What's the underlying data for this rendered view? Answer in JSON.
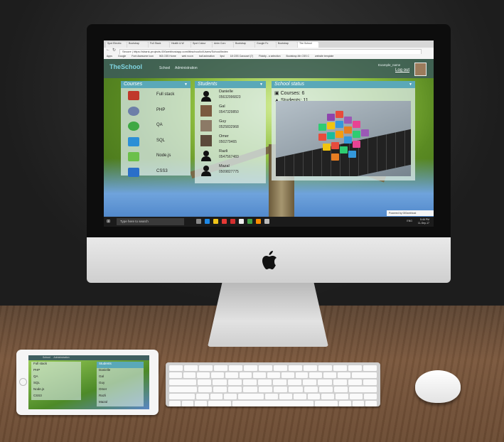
{
  "browser": {
    "tabs": [
      "Spot Electric",
      "Bootstrap",
      "Full Stack",
      "Health & W",
      "Spot Colour",
      "Anim Curv",
      "Bootstrap",
      "Google Fo",
      "Bootstrap",
      "The School"
    ],
    "url": "Secure | https://shank-projects.000webhostapp.com/ltbschool/ci/Users/School/Index",
    "bookmarks": [
      "Apps",
      "Google",
      "Font Awesome Icon",
      "W3.CSS Home",
      "web תכנות",
      "ball animation",
      "lipsi",
      "18 CSS Carousel (7)",
      "Flickity - a selection",
      "Bootstrap 4th CSS C",
      "website template"
    ]
  },
  "site": {
    "logo": "TheSchool",
    "nav": [
      "School",
      "Administration"
    ],
    "user_name": "Example_name",
    "logout": "Log out",
    "powered_by": "Powered by 000webhost"
  },
  "courses": {
    "title": "Courses",
    "items": [
      {
        "label": "Full stack",
        "icon": "full-stack-logo",
        "color": "#c0392b"
      },
      {
        "label": "PHP",
        "icon": "php-elephant-logo",
        "color": "#6d7fa8"
      },
      {
        "label": "QA",
        "icon": "qa-logo",
        "color": "#3ea843"
      },
      {
        "label": "SQL",
        "icon": "sql-database-logo",
        "color": "#2c8fd6"
      },
      {
        "label": "Node.js",
        "icon": "nodejs-logo",
        "color": "#6cc04a"
      },
      {
        "label": "CSS3",
        "icon": "css3-logo",
        "color": "#2a6fc9"
      }
    ]
  },
  "students": {
    "title": "Students",
    "items": [
      {
        "name": "Danielle",
        "phone": "05632996823"
      },
      {
        "name": "Gal",
        "phone": "0547329850"
      },
      {
        "name": "Guy",
        "phone": "0525832968"
      },
      {
        "name": "Omer",
        "phone": "050279465"
      },
      {
        "name": "Razli",
        "phone": "0547567483"
      },
      {
        "name": "Mazal",
        "phone": "0509827775"
      }
    ]
  },
  "status": {
    "title": "School status",
    "courses_line": "Courses: 6",
    "students_line": "Students: 11"
  },
  "taskbar": {
    "search_placeholder": "Type here to search",
    "lang": "ENG",
    "time": "5:46 PM",
    "date": "11-Sep-17"
  },
  "ipad": {
    "nav": [
      "School",
      "Administration"
    ],
    "courses_title": "Courses",
    "students_title": "Students",
    "courses": [
      "Full stack",
      "PHP",
      "QA",
      "SQL",
      "Node.js",
      "CSS3"
    ],
    "students": [
      "Danielle",
      "Gal",
      "Guy",
      "Omer",
      "Razli",
      "Mazal"
    ]
  },
  "colors": {
    "panel_header": "#5aa8b8",
    "navbar": "#3c5a5a",
    "taskbar": "#1b1b1b"
  }
}
